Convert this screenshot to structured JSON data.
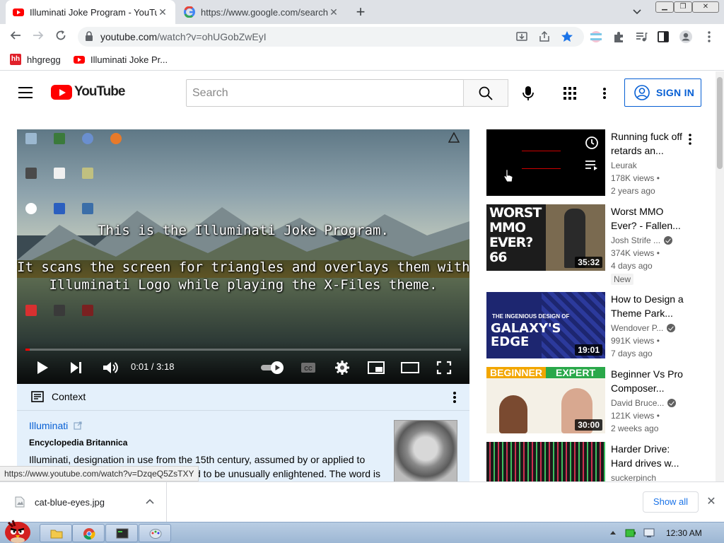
{
  "browser": {
    "tabs": [
      {
        "title": "Illuminati Joke Program - YouTube",
        "close": "✕"
      },
      {
        "title": "https://www.google.com/search",
        "close": "✕"
      }
    ],
    "new_tab": "+",
    "url_host": "youtube.com",
    "url_path": "/watch?v=ohUGobZwEyI",
    "bookmarks": [
      {
        "label": "hhgregg",
        "icon_text": "hh"
      },
      {
        "label": "Illuminati Joke Pr..."
      }
    ]
  },
  "youtube": {
    "search_placeholder": "Search",
    "signin_label": "SIGN IN",
    "player": {
      "caption_line1": "This is the Illuminati Joke Program.",
      "caption_line2": "It scans the screen for triangles and overlays them with the",
      "caption_line3": "Illuminati Logo while playing the X-Files theme.",
      "time": "0:01 / 3:18",
      "progress_fraction": 0.005
    },
    "context": {
      "header": "Context",
      "link": "Illuminati",
      "source": "Encyclopedia Britannica",
      "body": "Illuminati, designation in use from the 15th century, assumed by or applied to various groups of persons who claimed to be unusually enlightened. The word is"
    },
    "related": [
      {
        "title": "Running fuck off retards an...",
        "channel": "Leurak",
        "views": "178K views •",
        "age": "2 years ago",
        "duration": "",
        "verified": false
      },
      {
        "title": "Worst MMO Ever? - Fallen...",
        "channel": "Josh Strife ...",
        "views": "374K views •",
        "age": "4 days ago",
        "duration": "35:32",
        "verified": true,
        "badge": "New",
        "thumb_text": "WORST MMO EVER? 66"
      },
      {
        "title": "How to Design a Theme Park...",
        "channel": "Wendover P...",
        "views": "991K views •",
        "age": "7 days ago",
        "duration": "19:01",
        "verified": true,
        "thumb_text_small": "THE INGENIOUS DESIGN OF",
        "thumb_text": "GALAXY'S EDGE"
      },
      {
        "title": "Beginner Vs Pro Composer...",
        "channel": "David Bruce...",
        "views": "121K views •",
        "age": "2 weeks ago",
        "duration": "30:00",
        "verified": true,
        "thumb_left": "BEGINNER",
        "thumb_right": "EXPERT"
      },
      {
        "title": "Harder Drive: Hard drives w...",
        "channel": "suckerpinch",
        "views": "",
        "age": "",
        "duration": "",
        "verified": false
      }
    ]
  },
  "status_url": "https://www.youtube.com/watch?v=DzqeQ5ZsTXY",
  "download": {
    "filename": "cat-blue-eyes.jpg",
    "show_all": "Show all",
    "close": "✕"
  },
  "taskbar": {
    "clock": "12:30 AM"
  },
  "colors": {
    "yt_red": "#ff0000",
    "link_blue": "#065fd4",
    "context_bg": "#e4f0fb"
  }
}
